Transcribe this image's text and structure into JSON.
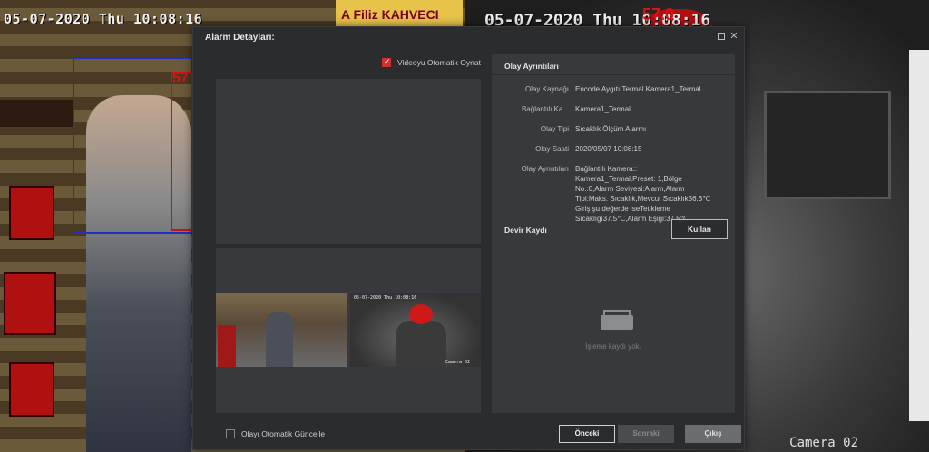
{
  "background": {
    "left_osd": "05-07-2020 Thu 10:08:16",
    "left_sign": "A Filiz KAHVECI",
    "left_tag": "57",
    "right_osd": "05-07-2020 Thu 10:08:16",
    "right_tag": "57.0",
    "right_cam_label": "Camera 02"
  },
  "dialog": {
    "title": "Alarm Detayları:",
    "autoplay_label": "Videoyu Otomatik Oynat",
    "autoplay_checked": true,
    "auto_update_label": "Olayı Otomatik Güncelle",
    "auto_update_checked": false
  },
  "thumbnails": {
    "right_osd": "05-07-2020 Thu 10:08:16",
    "right_cam": "Camera 02"
  },
  "details": {
    "heading": "Olay Ayrıntıları",
    "rows": [
      {
        "label": "Olay Kaynağı",
        "value": "Encode Aygıtı:Termal Kamera1_Termal"
      },
      {
        "label": "Bağlantılı Ka...",
        "value": "Kamera1_Termal"
      },
      {
        "label": "Olay Tipi",
        "value": "Sıcaklık Ölçüm Alarmı"
      },
      {
        "label": "Olay Saati",
        "value": "2020/05/07 10:08:15"
      },
      {
        "label": "Olay Ayrıntıları",
        "value": "Bağlantılı Kamera:: Kamera1_Termal,Preset: 1,Bölge No.:0,Alarm Seviyesi:Alarm,Alarm Tipi:Maks. Sıcaklık,Mevcut Sıcaklık56.3℃ Giriş şu değerde iseTetikleme Sıcaklığı37.5℃,Alarm Eşiği:37.5℃"
      }
    ]
  },
  "handover": {
    "heading": "Devir Kaydı",
    "use_button": "Kullan",
    "empty_text": "İşleme kaydı yok."
  },
  "footer": {
    "prev": "Önceki",
    "next": "Sonraki",
    "exit": "Çıkış"
  }
}
